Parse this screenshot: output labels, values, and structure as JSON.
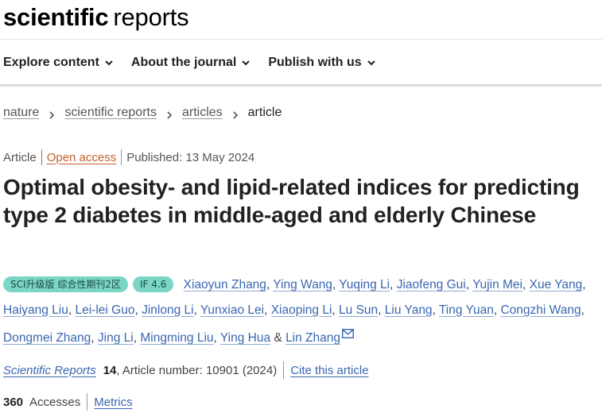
{
  "brand": {
    "bold": "scientific",
    "regular": "reports"
  },
  "nav": {
    "items": [
      {
        "label": "Explore content"
      },
      {
        "label": "About the journal"
      },
      {
        "label": "Publish with us"
      }
    ]
  },
  "breadcrumb": {
    "items": [
      "nature",
      "scientific reports",
      "articles"
    ],
    "current": "article"
  },
  "article": {
    "type": "Article",
    "access": "Open access",
    "published": "Published: 13 May 2024",
    "title": "Optimal obesity- and lipid-related indices for predicting type 2 diabetes in middle-aged and elderly Chinese",
    "badges": {
      "partition": "SCI升级版 综合性期刊2区",
      "impact": "IF 4.6"
    },
    "authors": [
      "Xiaoyun Zhang",
      "Ying Wang",
      "Yuqing Li",
      "Jiaofeng Gui",
      "Yujin Mei",
      "Xue Yang",
      "Haiyang Liu",
      "Lei-lei Guo",
      "Jinlong Li",
      "Yunxiao Lei",
      "Xiaoping Li",
      "Lu Sun",
      "Liu Yang",
      "Ting Yuan",
      "Congzhi Wang",
      "Dongmei Zhang",
      "Jing Li",
      "Mingming Liu",
      "Ying Hua",
      "Lin Zhang"
    ],
    "last_joiner": "&",
    "journal": "Scientific Reports",
    "volume": "14",
    "article_number": ", Article number: 10901 (2024)",
    "cite_label": "Cite this article",
    "accesses_count": "360",
    "accesses_label": "Accesses",
    "metrics_label": "Metrics"
  },
  "colors": {
    "link": "#3a67b0",
    "open_access": "#c0622b",
    "badge": "#7bd6c6"
  },
  "icons": {
    "nav": "chevron-down-icon",
    "breadcrumb": "chevron-right-icon",
    "corresponding": "mail-icon"
  }
}
